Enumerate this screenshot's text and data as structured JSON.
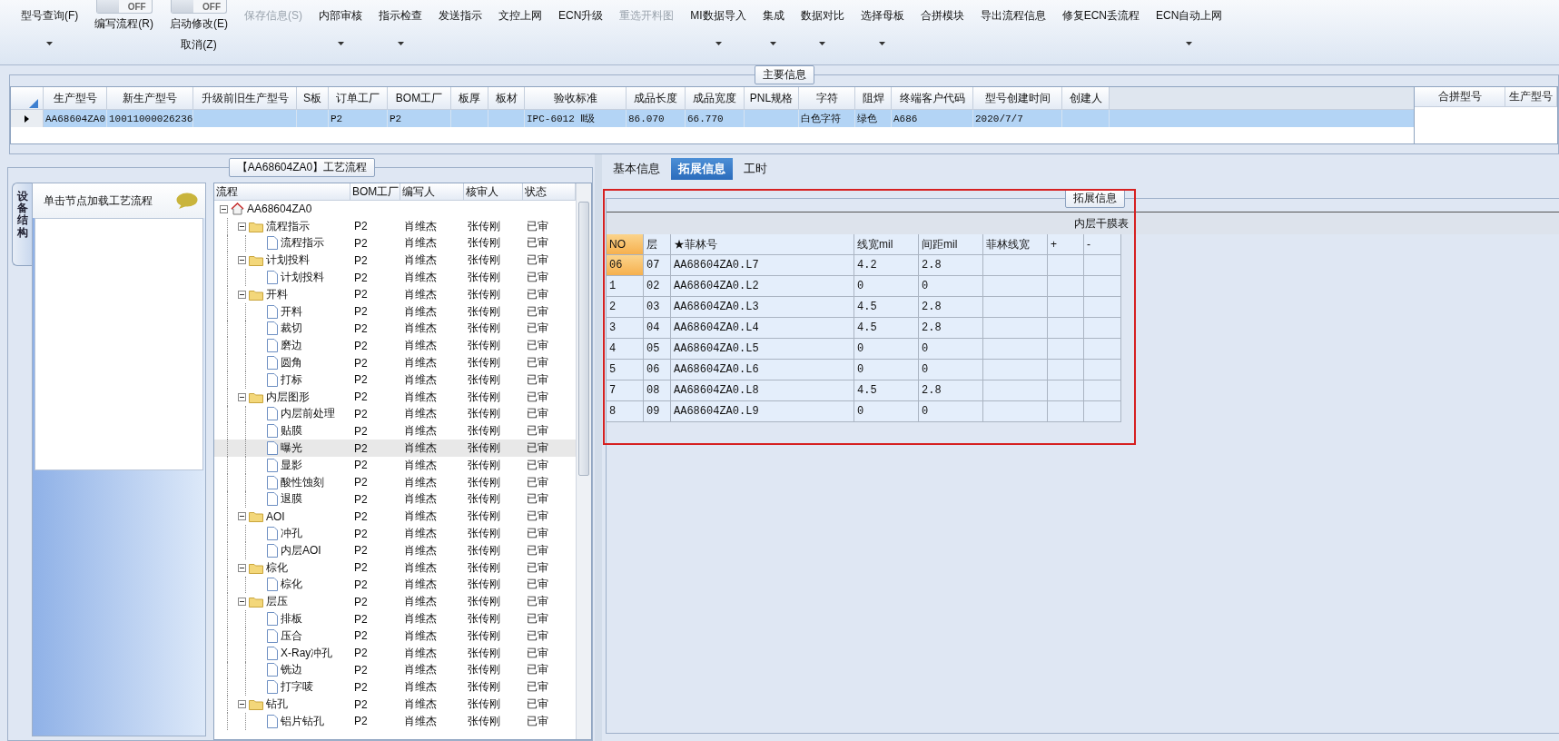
{
  "toolbar": [
    {
      "label": "型号查询(F)",
      "kind": "button",
      "dropdown": true,
      "disabled": false
    },
    {
      "label": "编写流程(R)",
      "kind": "toggle",
      "switch": "OFF",
      "on": false,
      "disabled": false
    },
    {
      "label": "启动修改(E)",
      "kind": "toggle",
      "switch": "OFF",
      "on": false,
      "sub_label": "取消(Z)",
      "disabled": false
    },
    {
      "label": "保存信息(S)",
      "kind": "button",
      "dropdown": false,
      "disabled": true
    },
    {
      "label": "内部审核",
      "kind": "button",
      "dropdown": true,
      "disabled": false
    },
    {
      "label": "指示检查",
      "kind": "button",
      "dropdown": true,
      "disabled": false
    },
    {
      "label": "发送指示",
      "kind": "button",
      "dropdown": false,
      "disabled": false
    },
    {
      "label": "文控上网",
      "kind": "button",
      "dropdown": false,
      "disabled": false
    },
    {
      "label": "ECN升级",
      "kind": "button",
      "dropdown": false,
      "disabled": false
    },
    {
      "label": "重选开料图",
      "kind": "button",
      "dropdown": false,
      "disabled": true
    },
    {
      "label": "MI数据导入",
      "kind": "button",
      "dropdown": true,
      "disabled": false
    },
    {
      "label": "集成",
      "kind": "button",
      "dropdown": true,
      "disabled": false
    },
    {
      "label": "数据对比",
      "kind": "button",
      "dropdown": true,
      "disabled": false
    },
    {
      "label": "选择母板",
      "kind": "button",
      "dropdown": true,
      "disabled": false
    },
    {
      "label": "合拼模块",
      "kind": "button",
      "dropdown": false,
      "disabled": false
    },
    {
      "label": "导出流程信息",
      "kind": "button",
      "dropdown": false,
      "disabled": false
    },
    {
      "label": "修复ECN丢流程",
      "kind": "button",
      "dropdown": false,
      "disabled": false
    },
    {
      "label": "ECN自动上网",
      "kind": "button",
      "dropdown": true,
      "disabled": false
    }
  ],
  "main_info": {
    "title": "主要信息",
    "columns": [
      "生产型号",
      "新生产型号",
      "升级前旧生产型号",
      "S板",
      "订单工厂",
      "BOM工厂",
      "板厚",
      "板材",
      "验收标准",
      "成品长度",
      "成品宽度",
      "PNL规格",
      "字符",
      "阻焊",
      "终端客户代码",
      "型号创建时间",
      "创建人"
    ],
    "rows": [
      {
        "selected": true,
        "cells": [
          "AA68604ZA0",
          "10011000026236",
          null,
          null,
          "P2",
          "P2",
          null,
          null,
          "IPC-6012 Ⅱ级",
          "86.070",
          "66.770",
          null,
          "白色字符",
          "绿色",
          "A686",
          "2020/7/7",
          null
        ]
      }
    ],
    "side_columns": [
      "合拼型号",
      "生产型号"
    ]
  },
  "process": {
    "title": "【AA68604ZA0】工艺流程",
    "side_tab": "设备结构",
    "hint": "单击节点加载工艺流程",
    "columns": [
      "流程",
      "BOM工厂",
      "编写人",
      "核审人",
      "状态"
    ],
    "tree": [
      {
        "name": "AA68604ZA0",
        "kind": "root",
        "selected": false,
        "expanded": true,
        "children": [
          {
            "name": "流程指示",
            "kind": "folder",
            "bom": "P2",
            "writer": "肖维杰",
            "reviewer": "张传刚",
            "status": "已审",
            "selected": false,
            "expanded": true,
            "children": [
              {
                "name": "流程指示",
                "kind": "doc",
                "bom": "P2",
                "writer": "肖维杰",
                "reviewer": "张传刚",
                "status": "已审",
                "selected": false
              }
            ]
          },
          {
            "name": "计划投料",
            "kind": "folder",
            "bom": "P2",
            "writer": "肖维杰",
            "reviewer": "张传刚",
            "status": "已审",
            "selected": false,
            "expanded": true,
            "children": [
              {
                "name": "计划投料",
                "kind": "doc",
                "bom": "P2",
                "writer": "肖维杰",
                "reviewer": "张传刚",
                "status": "已审",
                "selected": false
              }
            ]
          },
          {
            "name": "开料",
            "kind": "folder",
            "bom": "P2",
            "writer": "肖维杰",
            "reviewer": "张传刚",
            "status": "已审",
            "selected": false,
            "expanded": true,
            "children": [
              {
                "name": "开料",
                "kind": "doc",
                "bom": "P2",
                "writer": "肖维杰",
                "reviewer": "张传刚",
                "status": "已审",
                "selected": false
              },
              {
                "name": "裁切",
                "kind": "doc",
                "bom": "P2",
                "writer": "肖维杰",
                "reviewer": "张传刚",
                "status": "已审",
                "selected": false
              },
              {
                "name": "磨边",
                "kind": "doc",
                "bom": "P2",
                "writer": "肖维杰",
                "reviewer": "张传刚",
                "status": "已审",
                "selected": false
              },
              {
                "name": "圆角",
                "kind": "doc",
                "bom": "P2",
                "writer": "肖维杰",
                "reviewer": "张传刚",
                "status": "已审",
                "selected": false
              },
              {
                "name": "打标",
                "kind": "doc",
                "bom": "P2",
                "writer": "肖维杰",
                "reviewer": "张传刚",
                "status": "已审",
                "selected": false
              }
            ]
          },
          {
            "name": "内层图形",
            "kind": "folder",
            "bom": "P2",
            "writer": "肖维杰",
            "reviewer": "张传刚",
            "status": "已审",
            "selected": false,
            "expanded": true,
            "children": [
              {
                "name": "内层前处理",
                "kind": "doc",
                "bom": "P2",
                "writer": "肖维杰",
                "reviewer": "张传刚",
                "status": "已审",
                "selected": false
              },
              {
                "name": "贴膜",
                "kind": "doc",
                "bom": "P2",
                "writer": "肖维杰",
                "reviewer": "张传刚",
                "status": "已审",
                "selected": false
              },
              {
                "name": "曝光",
                "kind": "doc",
                "bom": "P2",
                "writer": "肖维杰",
                "reviewer": "张传刚",
                "status": "已审",
                "selected": true
              },
              {
                "name": "显影",
                "kind": "doc",
                "bom": "P2",
                "writer": "肖维杰",
                "reviewer": "张传刚",
                "status": "已审",
                "selected": false
              },
              {
                "name": "酸性蚀刻",
                "kind": "doc",
                "bom": "P2",
                "writer": "肖维杰",
                "reviewer": "张传刚",
                "status": "已审",
                "selected": false
              },
              {
                "name": "退膜",
                "kind": "doc",
                "bom": "P2",
                "writer": "肖维杰",
                "reviewer": "张传刚",
                "status": "已审",
                "selected": false
              }
            ]
          },
          {
            "name": "AOI",
            "kind": "folder",
            "bom": "P2",
            "writer": "肖维杰",
            "reviewer": "张传刚",
            "status": "已审",
            "selected": false,
            "expanded": true,
            "children": [
              {
                "name": "冲孔",
                "kind": "doc",
                "bom": "P2",
                "writer": "肖维杰",
                "reviewer": "张传刚",
                "status": "已审",
                "selected": false
              },
              {
                "name": "内层AOI",
                "kind": "doc",
                "bom": "P2",
                "writer": "肖维杰",
                "reviewer": "张传刚",
                "status": "已审",
                "selected": false
              }
            ]
          },
          {
            "name": "棕化",
            "kind": "folder",
            "bom": "P2",
            "writer": "肖维杰",
            "reviewer": "张传刚",
            "status": "已审",
            "selected": false,
            "expanded": true,
            "children": [
              {
                "name": "棕化",
                "kind": "doc",
                "bom": "P2",
                "writer": "肖维杰",
                "reviewer": "张传刚",
                "status": "已审",
                "selected": false
              }
            ]
          },
          {
            "name": "层压",
            "kind": "folder",
            "bom": "P2",
            "writer": "肖维杰",
            "reviewer": "张传刚",
            "status": "已审",
            "selected": false,
            "expanded": true,
            "children": [
              {
                "name": "排板",
                "kind": "doc",
                "bom": "P2",
                "writer": "肖维杰",
                "reviewer": "张传刚",
                "status": "已审",
                "selected": false
              },
              {
                "name": "压合",
                "kind": "doc",
                "bom": "P2",
                "writer": "肖维杰",
                "reviewer": "张传刚",
                "status": "已审",
                "selected": false
              },
              {
                "name": "X-Ray冲孔",
                "kind": "doc",
                "bom": "P2",
                "writer": "肖维杰",
                "reviewer": "张传刚",
                "status": "已审",
                "selected": false
              },
              {
                "name": "铣边",
                "kind": "doc",
                "bom": "P2",
                "writer": "肖维杰",
                "reviewer": "张传刚",
                "status": "已审",
                "selected": false
              },
              {
                "name": "打字唛",
                "kind": "doc",
                "bom": "P2",
                "writer": "肖维杰",
                "reviewer": "张传刚",
                "status": "已审",
                "selected": false
              }
            ]
          },
          {
            "name": "钻孔",
            "kind": "folder",
            "bom": "P2",
            "writer": "肖维杰",
            "reviewer": "张传刚",
            "status": "已审",
            "selected": false,
            "expanded": true,
            "children": [
              {
                "name": "铝片钻孔",
                "kind": "doc",
                "bom": "P2",
                "writer": "肖维杰",
                "reviewer": "张传刚",
                "status": "已审",
                "selected": false
              }
            ]
          }
        ]
      }
    ]
  },
  "detail": {
    "tabs": [
      {
        "label": "基本信息",
        "selected": false
      },
      {
        "label": "拓展信息",
        "selected": true
      },
      {
        "label": "工时",
        "selected": false
      }
    ],
    "group_title": "拓展信息",
    "table_title": "内层干膜表",
    "columns": [
      "NO",
      "层",
      "★菲林号",
      "线宽mil",
      "间距mil",
      "菲林线宽",
      "+",
      "-"
    ],
    "rows": [
      {
        "selected": true,
        "cells": [
          "06",
          "07",
          "AA68604ZA0.L7",
          "4.2",
          "2.8"
        ]
      },
      {
        "selected": false,
        "cells": [
          "1",
          "02",
          "AA68604ZA0.L2",
          "0",
          "0"
        ]
      },
      {
        "selected": false,
        "cells": [
          "2",
          "03",
          "AA68604ZA0.L3",
          "4.5",
          "2.8"
        ]
      },
      {
        "selected": false,
        "cells": [
          "3",
          "04",
          "AA68604ZA0.L4",
          "4.5",
          "2.8"
        ]
      },
      {
        "selected": false,
        "cells": [
          "4",
          "05",
          "AA68604ZA0.L5",
          "0",
          "0"
        ]
      },
      {
        "selected": false,
        "cells": [
          "5",
          "06",
          "AA68604ZA0.L6",
          "0",
          "0"
        ]
      },
      {
        "selected": false,
        "cells": [
          "7",
          "08",
          "AA68604ZA0.L8",
          "4.5",
          "2.8"
        ]
      },
      {
        "selected": false,
        "cells": [
          "8",
          "09",
          "AA68604ZA0.L9",
          "0",
          "0"
        ]
      }
    ]
  }
}
